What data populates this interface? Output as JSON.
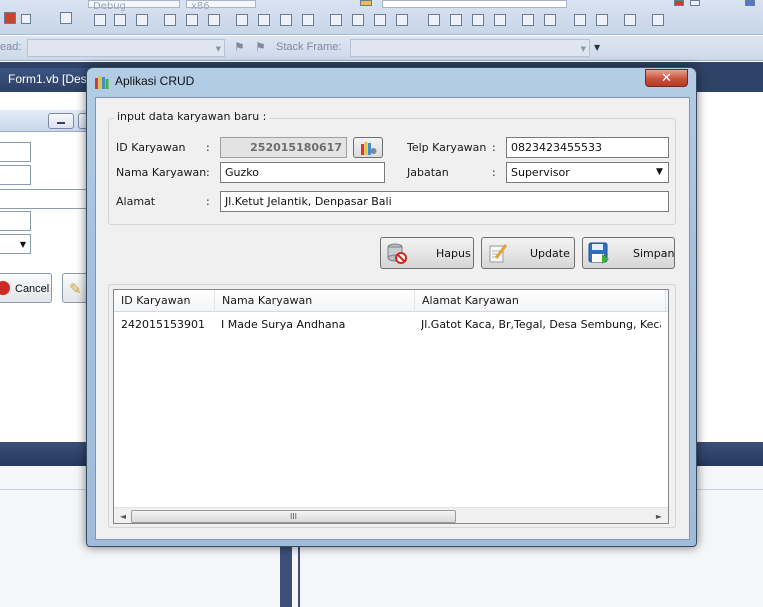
{
  "ide": {
    "toolbar": {
      "config_value": "Debug",
      "platform_value": "x86",
      "thread_label": "ead:",
      "stack_frame_label": "Stack Frame:"
    },
    "doc_tab": "Form1.vb [Des",
    "cancel_label": "Cancel"
  },
  "dialog": {
    "title": "Aplikasi CRUD",
    "close_glyph": "✕",
    "group_title": "input data karyawan baru :",
    "fields": {
      "id": {
        "label": "ID Karyawan",
        "colon": ":",
        "value": "252015180617"
      },
      "nama": {
        "label": "Nama Karyawan",
        "colon": ":",
        "value": "Guzko"
      },
      "alamat": {
        "label": "Alamat",
        "colon": ":",
        "value": "Jl.Ketut Jelantik, Denpasar Bali"
      },
      "telp": {
        "label": "Telp Karyawan",
        "colon": ":",
        "value": "0823423455533"
      },
      "jabatan": {
        "label": "Jabatan",
        "colon": ":",
        "selected": "Supervisor",
        "arrow": "▼"
      }
    },
    "buttons": {
      "hapus": "Hapus",
      "update": "Update",
      "simpan": "Simpan"
    },
    "table": {
      "columns": [
        "ID Karyawan",
        "Nama Karyawan",
        "Alamat Karyawan"
      ],
      "rows": [
        [
          "242015153901",
          "I Made Surya Andhana",
          "Jl.Gatot Kaca, Br,Tegal, Desa Sembung, Keca..."
        ]
      ],
      "scroll_left": "◄",
      "scroll_right": "►",
      "scroll_grip": "III"
    }
  }
}
